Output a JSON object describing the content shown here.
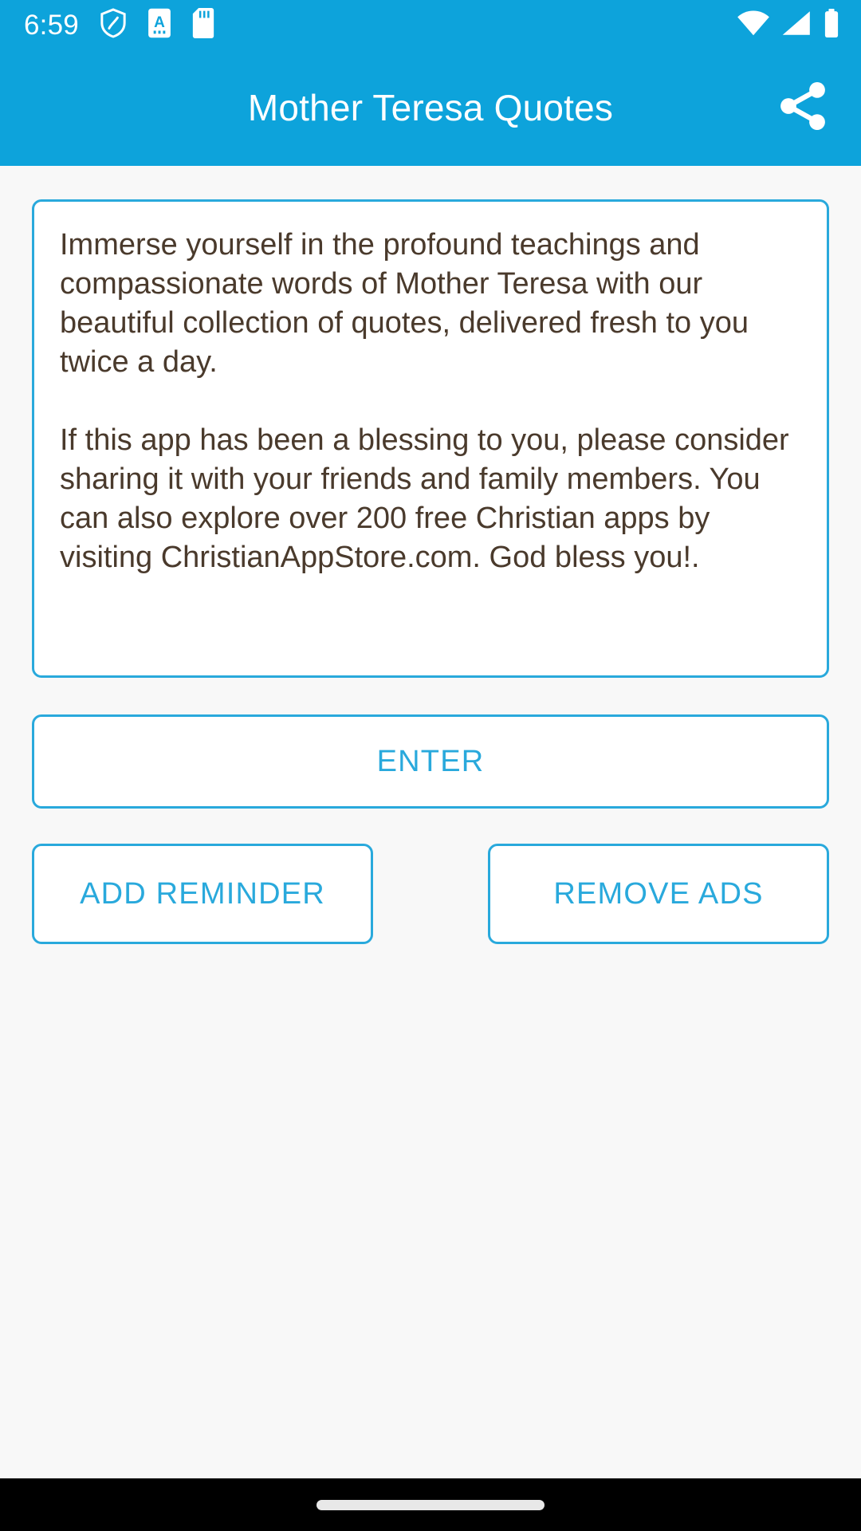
{
  "status_bar": {
    "time": "6:59",
    "left_icons": [
      {
        "name": "shield-icon"
      },
      {
        "name": "letter-a-badge-icon"
      },
      {
        "name": "sd-card-icon"
      }
    ],
    "right_icons": [
      {
        "name": "wifi-icon"
      },
      {
        "name": "cellular-signal-icon"
      },
      {
        "name": "battery-full-icon"
      }
    ],
    "background_color": "#0da3db",
    "foreground_color": "#ffffff"
  },
  "app_bar": {
    "title": "Mother Teresa Quotes",
    "share_icon": "share-icon",
    "background_color": "#0da3db",
    "title_color": "#ffffff"
  },
  "card": {
    "paragraphs": [
      "Immerse yourself in the profound teachings and compassionate words of Mother Teresa with our beautiful collection of quotes, delivered fresh to you twice a day.",
      "If this app has been a blessing to you, please consider sharing it with your friends and family members. You can also explore over 200 free Christian apps by visiting ChristianAppStore.com. God bless you!."
    ],
    "border_color": "#29a9dc",
    "text_color": "#4a3a2c",
    "background_color": "#ffffff"
  },
  "buttons": {
    "enter": "ENTER",
    "add_reminder": "ADD REMINDER",
    "remove_ads": "REMOVE ADS",
    "border_color": "#29a9dc",
    "label_color": "#29a9dc"
  },
  "nav_bar": {
    "gesture_pill": "home-gesture-pill",
    "background_color": "#000000",
    "pill_color": "#e8e8e8"
  },
  "page": {
    "background_color": "#f8f8f8"
  }
}
